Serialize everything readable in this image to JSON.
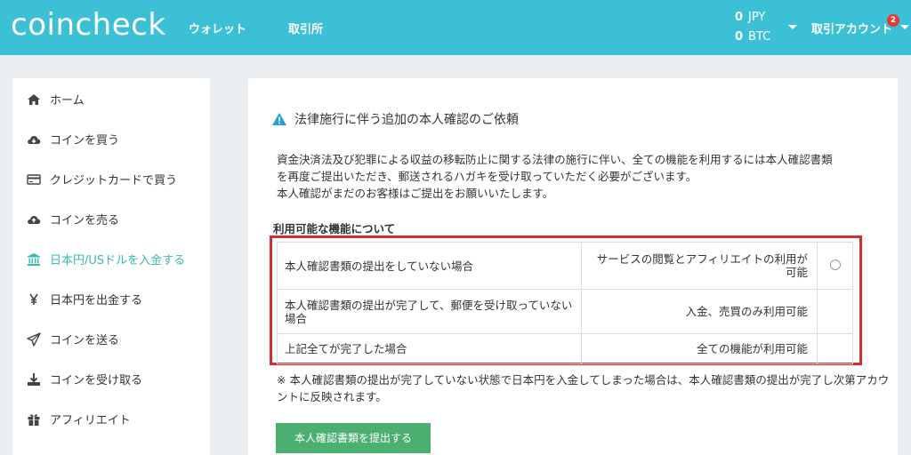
{
  "header": {
    "logo": "coincheck",
    "nav": {
      "wallet": "ウォレット",
      "exchange": "取引所"
    },
    "balances": [
      {
        "amount": "0",
        "currency": "JPY"
      },
      {
        "amount": "0",
        "currency": "BTC"
      }
    ],
    "account_label": "取引アカウント",
    "notification_count": "2"
  },
  "sidebar": {
    "items": [
      {
        "label": "ホーム",
        "icon": "home-icon"
      },
      {
        "label": "コインを買う",
        "icon": "cloud-download-icon"
      },
      {
        "label": "クレジットカードで買う",
        "icon": "credit-card-icon"
      },
      {
        "label": "コインを売る",
        "icon": "cloud-upload-icon"
      },
      {
        "label": "日本円/USドルを入金する",
        "icon": "bank-icon",
        "active": true
      },
      {
        "label": "日本円を出金する",
        "icon": "yen-icon"
      },
      {
        "label": "コインを送る",
        "icon": "paper-plane-icon"
      },
      {
        "label": "コインを受け取る",
        "icon": "download-icon"
      },
      {
        "label": "アフィリエイト",
        "icon": "gift-icon"
      }
    ],
    "active_color": "#3bb8b0"
  },
  "main": {
    "notice_title": "法律施行に伴う追加の本人確認のご依頼",
    "description": [
      "資金決済法及び犯罪による収益の移転防止に関する法律の施行に伴い、全ての機能を利用するには本人確認書類",
      "を再度ご提出いただき、郵送されるハガキを受け取っていただく必要がございます。",
      "本人確認がまだのお客様はご提出をお願いいたします。"
    ],
    "features_title": "利用可能な機能について",
    "features_table": [
      {
        "condition": "本人確認書類の提出をしていない場合",
        "availability": "サービスの閲覧とアフィリエイトの利用が可能"
      },
      {
        "condition": "本人確認書類の提出が完了して、郵便を受け取っていない場合",
        "availability": "入金、売買のみ利用可能"
      },
      {
        "condition": "上記全てが完了した場合",
        "availability": "全ての機能が利用可能"
      }
    ],
    "footnote": "※ 本人確認書類の提出が完了していない状態で日本円を入金してしまった場合は、本人確認書類の提出が完了し次第アカウントに反映されます。",
    "submit_label": "本人確認書類を提出する"
  },
  "colors": {
    "header_bg": "#3bc0d6",
    "highlight_border": "#d32f2f",
    "submit_bg": "#4caf72",
    "warning_icon": "#2a9fd6"
  }
}
